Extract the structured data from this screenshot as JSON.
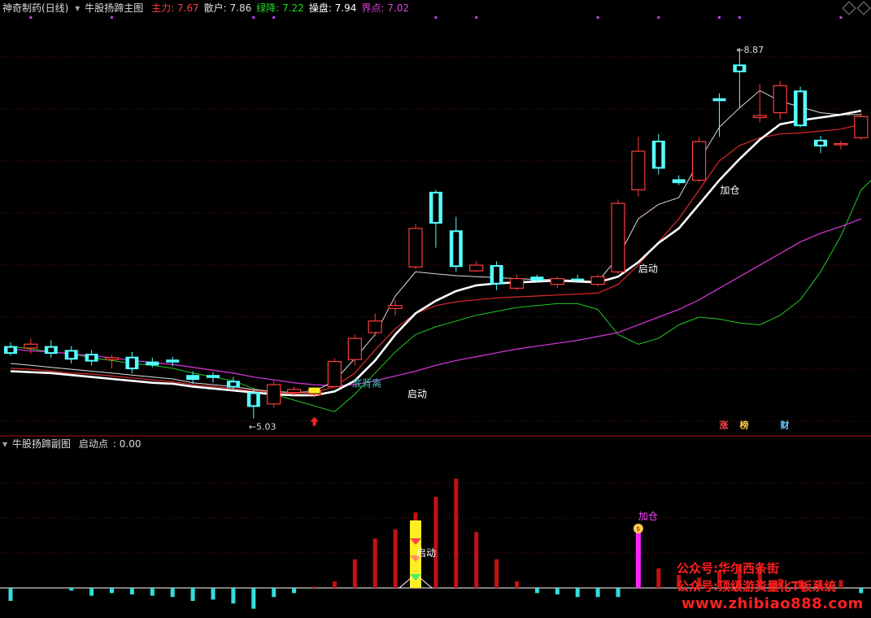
{
  "main_header": {
    "stock_name": "神奇制药(日线)",
    "indicator_name": "牛股扬蹄主图",
    "values": [
      {
        "label": "主力",
        "value": "7.67",
        "color": "#ff3c3c"
      },
      {
        "label": "散户",
        "value": "7.86",
        "color": "#e0e0e0"
      },
      {
        "label": "绿降",
        "value": "7.22",
        "color": "#22dd22"
      },
      {
        "label": "操盘",
        "value": "7.94",
        "color": "#ffffff"
      },
      {
        "label": "界点",
        "value": "7.02",
        "color": "#e040e0"
      }
    ]
  },
  "sub_header": {
    "indicator_name": "牛股扬蹄副图",
    "label": "启动点",
    "value": "0.00"
  },
  "annotations": {
    "high_price": "8.87",
    "low_price": "5.03",
    "bottom_label": "底背离",
    "start_labels": [
      "启动",
      "启动"
    ],
    "add_label": "加仓",
    "sub_start_label": "启动",
    "sub_add_label": "加仓"
  },
  "badges": [
    {
      "text": "涨",
      "color": "#ff4444"
    },
    {
      "text": "榜",
      "color": "#ffcc44"
    },
    {
      "text": "财",
      "color": "#66ccff"
    }
  ],
  "watermark": {
    "line1": "公众号:华尔西条街",
    "line2": "公众号:顶级游资量化T板系统",
    "line3": "www.zhibiao888.com"
  },
  "chart_data": {
    "type": "candlestick",
    "price_range": [
      4.9,
      9.2
    ],
    "candles": [
      {
        "o": 5.78,
        "h": 5.82,
        "l": 5.68,
        "c": 5.7
      },
      {
        "o": 5.76,
        "h": 5.86,
        "l": 5.7,
        "c": 5.8
      },
      {
        "o": 5.78,
        "h": 5.84,
        "l": 5.66,
        "c": 5.7
      },
      {
        "o": 5.74,
        "h": 5.78,
        "l": 5.6,
        "c": 5.64
      },
      {
        "o": 5.7,
        "h": 5.74,
        "l": 5.58,
        "c": 5.62
      },
      {
        "o": 5.64,
        "h": 5.69,
        "l": 5.55,
        "c": 5.66
      },
      {
        "o": 5.67,
        "h": 5.72,
        "l": 5.5,
        "c": 5.54
      },
      {
        "o": 5.62,
        "h": 5.66,
        "l": 5.56,
        "c": 5.58
      },
      {
        "o": 5.64,
        "h": 5.67,
        "l": 5.57,
        "c": 5.61
      },
      {
        "o": 5.48,
        "h": 5.52,
        "l": 5.39,
        "c": 5.43
      },
      {
        "o": 5.48,
        "h": 5.51,
        "l": 5.4,
        "c": 5.45
      },
      {
        "o": 5.42,
        "h": 5.46,
        "l": 5.32,
        "c": 5.35
      },
      {
        "o": 5.3,
        "h": 5.33,
        "l": 5.03,
        "c": 5.15
      },
      {
        "o": 5.18,
        "h": 5.42,
        "l": 5.14,
        "c": 5.38
      },
      {
        "o": 5.3,
        "h": 5.36,
        "l": 5.25,
        "c": 5.33
      },
      {
        "o": 5.28,
        "h": 5.35,
        "l": 5.25,
        "c": 5.32
      },
      {
        "o": 5.36,
        "h": 5.65,
        "l": 5.34,
        "c": 5.62
      },
      {
        "o": 5.64,
        "h": 5.9,
        "l": 5.58,
        "c": 5.86
      },
      {
        "o": 5.92,
        "h": 6.12,
        "l": 5.88,
        "c": 6.04
      },
      {
        "o": 6.17,
        "h": 6.26,
        "l": 6.1,
        "c": 6.2
      },
      {
        "o": 6.6,
        "h": 7.05,
        "l": 6.58,
        "c": 7.0
      },
      {
        "o": 7.38,
        "h": 7.4,
        "l": 6.8,
        "c": 7.05
      },
      {
        "o": 6.98,
        "h": 7.12,
        "l": 6.55,
        "c": 6.6
      },
      {
        "o": 6.56,
        "h": 6.66,
        "l": 6.55,
        "c": 6.62
      },
      {
        "o": 6.62,
        "h": 6.66,
        "l": 6.36,
        "c": 6.42
      },
      {
        "o": 6.38,
        "h": 6.52,
        "l": 6.36,
        "c": 6.48
      },
      {
        "o": 6.5,
        "h": 6.52,
        "l": 6.44,
        "c": 6.46
      },
      {
        "o": 6.42,
        "h": 6.5,
        "l": 6.38,
        "c": 6.48
      },
      {
        "o": 6.48,
        "h": 6.52,
        "l": 6.44,
        "c": 6.46
      },
      {
        "o": 6.42,
        "h": 6.52,
        "l": 6.4,
        "c": 6.5
      },
      {
        "o": 6.55,
        "h": 7.3,
        "l": 6.53,
        "c": 7.26
      },
      {
        "o": 7.4,
        "h": 7.95,
        "l": 7.33,
        "c": 7.8
      },
      {
        "o": 7.91,
        "h": 7.98,
        "l": 7.56,
        "c": 7.62
      },
      {
        "o": 7.51,
        "h": 7.55,
        "l": 7.45,
        "c": 7.47
      },
      {
        "o": 7.5,
        "h": 7.95,
        "l": 7.48,
        "c": 7.9
      },
      {
        "o": 8.35,
        "h": 8.4,
        "l": 7.95,
        "c": 8.32
      },
      {
        "o": 8.7,
        "h": 8.87,
        "l": 8.25,
        "c": 8.62
      },
      {
        "o": 8.15,
        "h": 8.5,
        "l": 8.1,
        "c": 8.17
      },
      {
        "o": 8.2,
        "h": 8.53,
        "l": 8.13,
        "c": 8.48
      },
      {
        "o": 8.43,
        "h": 8.47,
        "l": 8.05,
        "c": 8.06
      },
      {
        "o": 7.92,
        "h": 7.96,
        "l": 7.78,
        "c": 7.85
      },
      {
        "o": 7.87,
        "h": 7.91,
        "l": 7.82,
        "c": 7.88
      },
      {
        "o": 7.94,
        "h": 8.2,
        "l": 7.92,
        "c": 8.16
      }
    ],
    "series": [
      {
        "key": "cao_pan",
        "values": [
          5.52,
          5.51,
          5.5,
          5.48,
          5.46,
          5.44,
          5.42,
          5.4,
          5.39,
          5.36,
          5.34,
          5.32,
          5.3,
          5.28,
          5.27,
          5.27,
          5.31,
          5.42,
          5.63,
          5.9,
          6.12,
          6.25,
          6.35,
          6.41,
          6.43,
          6.44,
          6.45,
          6.46,
          6.45,
          6.44,
          6.5,
          6.65,
          6.85,
          7.0,
          7.25,
          7.5,
          7.72,
          7.92,
          8.08,
          8.12,
          8.15,
          8.18,
          8.22
        ]
      },
      {
        "key": "zhu_li",
        "values": [
          5.55,
          5.54,
          5.52,
          5.5,
          5.49,
          5.47,
          5.45,
          5.43,
          5.41,
          5.38,
          5.36,
          5.34,
          5.32,
          5.3,
          5.29,
          5.3,
          5.36,
          5.5,
          5.74,
          5.96,
          6.12,
          6.2,
          6.24,
          6.26,
          6.28,
          6.29,
          6.3,
          6.31,
          6.32,
          6.33,
          6.42,
          6.62,
          6.86,
          7.1,
          7.4,
          7.7,
          7.86,
          7.94,
          7.98,
          7.99,
          8.01,
          8.03,
          8.08
        ]
      },
      {
        "key": "san_hu",
        "values": [
          5.6,
          5.58,
          5.56,
          5.54,
          5.52,
          5.5,
          5.48,
          5.46,
          5.44,
          5.4,
          5.38,
          5.36,
          5.33,
          5.31,
          5.3,
          5.31,
          5.42,
          5.65,
          5.9,
          6.3,
          6.55,
          6.53,
          6.51,
          6.5,
          6.49,
          6.48,
          6.47,
          6.47,
          6.46,
          6.45,
          6.7,
          7.1,
          7.25,
          7.32,
          7.7,
          8.05,
          8.25,
          8.43,
          8.32,
          8.26,
          8.2,
          8.18,
          8.18
        ]
      },
      {
        "key": "lv_jiang",
        "values": [
          5.78,
          5.75,
          5.72,
          5.7,
          5.66,
          5.63,
          5.6,
          5.58,
          5.55,
          5.5,
          5.46,
          5.42,
          5.34,
          5.28,
          5.22,
          5.16,
          5.1,
          5.28,
          5.5,
          5.72,
          5.9,
          5.98,
          6.04,
          6.1,
          6.14,
          6.18,
          6.2,
          6.22,
          6.22,
          6.16,
          5.9,
          5.8,
          5.86,
          6.0,
          6.08,
          6.06,
          6.02,
          6.0,
          6.1,
          6.26,
          6.55,
          6.92,
          7.4,
          7.6,
          7.7
        ]
      },
      {
        "key": "jie_dian",
        "values": [
          5.75,
          5.73,
          5.72,
          5.7,
          5.68,
          5.66,
          5.63,
          5.61,
          5.59,
          5.56,
          5.53,
          5.5,
          5.46,
          5.43,
          5.4,
          5.38,
          5.37,
          5.38,
          5.42,
          5.47,
          5.52,
          5.58,
          5.63,
          5.67,
          5.71,
          5.75,
          5.78,
          5.81,
          5.84,
          5.88,
          5.92,
          6.0,
          6.08,
          6.16,
          6.26,
          6.38,
          6.5,
          6.62,
          6.74,
          6.86,
          6.95,
          7.02,
          7.1
        ]
      }
    ],
    "sub_values": [
      -0.1,
      0.0,
      0.0,
      -0.02,
      -0.06,
      -0.04,
      -0.05,
      -0.06,
      -0.07,
      -0.1,
      -0.09,
      -0.12,
      -0.16,
      -0.07,
      -0.04,
      0.01,
      0.05,
      0.22,
      0.38,
      0.45,
      0.58,
      0.7,
      0.84,
      0.43,
      0.22,
      0.05,
      -0.04,
      -0.05,
      -0.07,
      -0.07,
      -0.07,
      0.22,
      0.15,
      0.1,
      0.08,
      0.13,
      0.17,
      0.16,
      0.07,
      0.06,
      0.06,
      0.06,
      -0.04
    ]
  }
}
